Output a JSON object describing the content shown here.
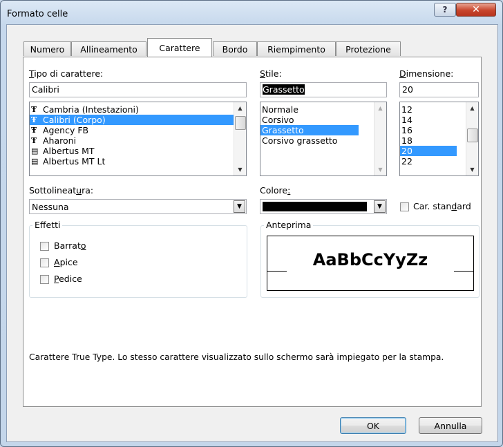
{
  "window": {
    "title": "Formato celle",
    "help_label": "?",
    "close_label": "✕"
  },
  "tabs": [
    {
      "label": "Numero"
    },
    {
      "label": "Allineamento"
    },
    {
      "label": "Carattere"
    },
    {
      "label": "Bordo"
    },
    {
      "label": "Riempimento"
    },
    {
      "label": "Protezione"
    }
  ],
  "active_tab": "Carattere",
  "font": {
    "label_pre": "T",
    "label_rest": "ipo di carattere:",
    "value": "Calibri",
    "items": [
      "Cambria (Intestazioni)",
      "Calibri (Corpo)",
      "Agency FB",
      "Aharoni",
      "Albertus MT",
      "Albertus MT Lt"
    ],
    "selected": "Calibri (Corpo)"
  },
  "style": {
    "label_pre": "S",
    "label_rest": "tile:",
    "value": "Grassetto",
    "items": [
      "Normale",
      "Corsivo",
      "Grassetto",
      "Corsivo grassetto"
    ],
    "selected": "Grassetto"
  },
  "size": {
    "label_pre": "D",
    "label_rest": "imensione:",
    "value": "20",
    "items": [
      "12",
      "14",
      "16",
      "18",
      "20",
      "22"
    ],
    "selected": "20"
  },
  "underline": {
    "label_pre": "Sottolineat",
    "label_u": "u",
    "label_post": "ra:",
    "value": "Nessuna"
  },
  "color": {
    "label_pre": "Colore",
    "label_u": ":",
    "value_color": "#000000"
  },
  "normal_font": {
    "label_pre": "Car. stan",
    "label_u": "d",
    "label_post": "ard"
  },
  "effects": {
    "title": "Effetti",
    "strike": {
      "pre": "Barrat",
      "u": "o"
    },
    "superscript": {
      "pre": "",
      "u": "A",
      "post": "pice"
    },
    "subscript": {
      "pre": "",
      "u": "P",
      "post": "edice"
    }
  },
  "preview": {
    "title": "Anteprima",
    "sample": "AaBbCcYyZz"
  },
  "info_text": "Carattere True Type. Lo stesso carattere visualizzato sullo schermo sarà impiegato per la stampa.",
  "buttons": {
    "ok": "OK",
    "cancel": "Annulla"
  },
  "icons": {
    "truetype": "truetype-font-icon",
    "printer": "printer-font-icon"
  }
}
